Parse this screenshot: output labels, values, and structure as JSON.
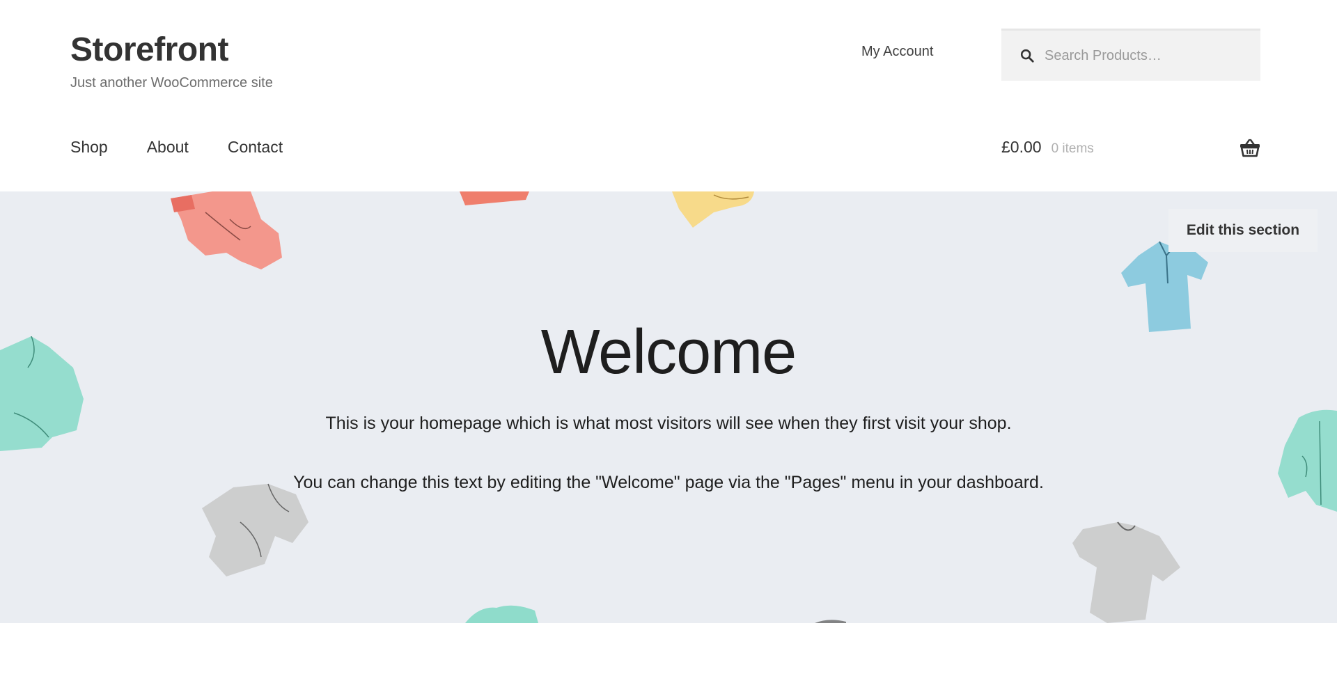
{
  "header": {
    "site_title": "Storefront",
    "tagline": "Just another WooCommerce site",
    "secondary_nav_link": "My Account",
    "search": {
      "placeholder": "Search Products…",
      "icon": "search-icon"
    },
    "primary_nav": [
      "Shop",
      "About",
      "Contact"
    ],
    "cart": {
      "amount": "£0.00",
      "count_label": "0 items",
      "icon": "basket-icon"
    }
  },
  "hero": {
    "edit_button": "Edit this section",
    "title": "Welcome",
    "paragraphs": [
      "This is your homepage which is what most visitors will see when they first visit your shop.",
      "You can change this text by editing the \"Welcome\" page via the \"Pages\" menu in your dashboard."
    ]
  },
  "colors": {
    "hero_background": "#eaedf2",
    "garment_coral": "#f4877a",
    "garment_yellow": "#f8d77e",
    "garment_mint": "#7fd8c4",
    "garment_blue": "#7cc4dc",
    "garment_grey": "#c8c8c8"
  }
}
